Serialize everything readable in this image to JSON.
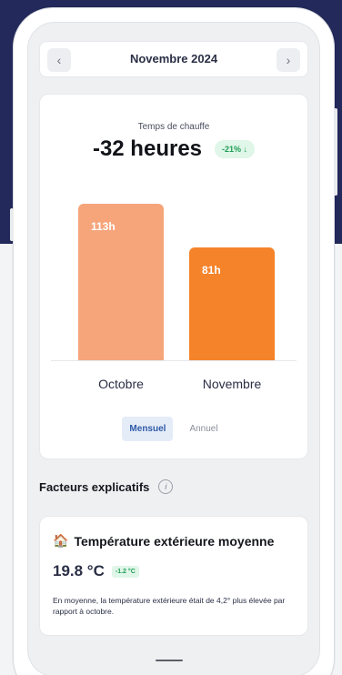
{
  "header": {
    "month": "Novembre 2024",
    "prev_icon": "chevron-left-icon",
    "next_icon": "chevron-right-icon"
  },
  "summary": {
    "caption": "Temps de chauffe",
    "value": "-32 heures",
    "change_badge": "-21% ↓"
  },
  "chart_data": {
    "type": "bar",
    "categories": [
      "Octobre",
      "Novembre"
    ],
    "values": [
      113,
      81
    ],
    "value_labels": [
      "113h",
      "81h"
    ],
    "ylim": [
      0,
      120
    ],
    "colors": [
      "#f6a57b",
      "#f5832a"
    ],
    "grid": false
  },
  "period_toggle": {
    "options": [
      "Mensuel",
      "Annuel"
    ],
    "selected": "Mensuel"
  },
  "factors": {
    "title": "Facteurs explicatifs",
    "info_icon": "info-icon",
    "items": [
      {
        "icon": "house-icon",
        "title": "Température extérieure moyenne",
        "value": "19.8 °C",
        "badge": "-1.2 °C",
        "description": "En moyenne, la température extérieure était de 4,2° plus élevée par rapport à octobre."
      }
    ]
  },
  "colors": {
    "background_top": "#23295a",
    "accent": "#2f5aa8",
    "positive": "#1f9d55"
  }
}
